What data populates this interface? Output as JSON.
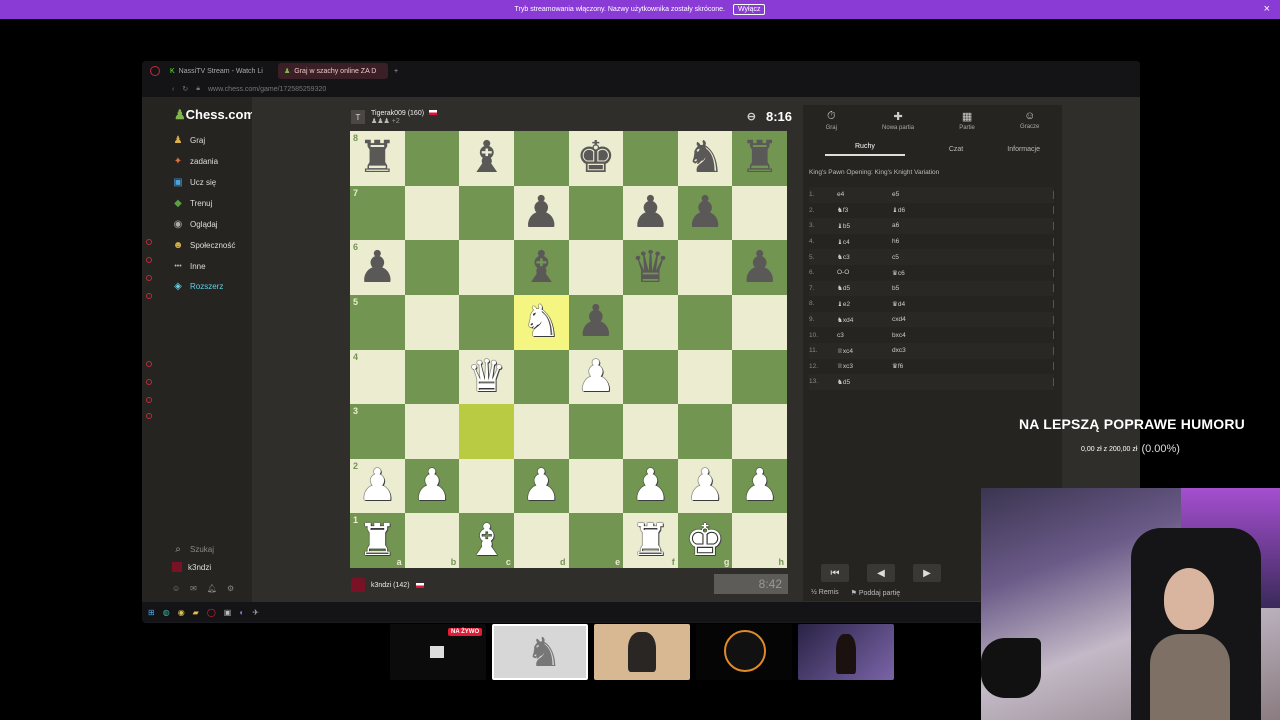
{
  "banner": {
    "text": "Tryb streamowania włączony. Nazwy użytkownika zostały skrócone.",
    "button": "Wyłącz",
    "close": "×"
  },
  "browser": {
    "tabs": [
      {
        "label": "NassiTV Stream - Watch Li"
      },
      {
        "label": "Graj w szachy online ZA D"
      }
    ],
    "new_tab": "+",
    "url": "www.chess.com/game/172585259320"
  },
  "site": {
    "logo_text": "Chess.com",
    "nav": [
      {
        "label": "Graj",
        "icon": "♟"
      },
      {
        "label": "zadania",
        "icon": "✦"
      },
      {
        "label": "Ucz się",
        "icon": "▣"
      },
      {
        "label": "Trenuj",
        "icon": "◆"
      },
      {
        "label": "Oglądaj",
        "icon": "◉"
      },
      {
        "label": "Społeczność",
        "icon": "☻"
      },
      {
        "label": "Inne",
        "icon": "•••"
      },
      {
        "label": "Rozszerz",
        "icon": "◈"
      }
    ],
    "search_label": "Szukaj",
    "user_label": "k3ndzi"
  },
  "game": {
    "opponent": {
      "name": "Tigerak009 (160)",
      "avatar": "T",
      "extra": "+2"
    },
    "player": {
      "name": "k3ndzi (142)"
    },
    "clock_top": "8:16",
    "clock_bottom": "8:42",
    "ranks": [
      "8",
      "7",
      "6",
      "5",
      "4",
      "3",
      "2",
      "1"
    ],
    "files": [
      "a",
      "b",
      "c",
      "d",
      "e",
      "f",
      "g",
      "h"
    ],
    "board": [
      [
        "br",
        "",
        "bb",
        "",
        "bk",
        "",
        "bn",
        "br"
      ],
      [
        "",
        "",
        "",
        "bp",
        "",
        "bp",
        "bp",
        ""
      ],
      [
        "bp",
        "",
        "",
        "bb",
        "",
        "bq",
        "",
        "bp"
      ],
      [
        "",
        "",
        "",
        "wn",
        "bp",
        "",
        "",
        ""
      ],
      [
        "",
        "",
        "wq",
        "",
        "wp",
        "",
        "",
        ""
      ],
      [
        "",
        "",
        "",
        "",
        "",
        "",
        "",
        ""
      ],
      [
        "wp",
        "wp",
        "",
        "wp",
        "",
        "wp",
        "wp",
        "wp"
      ],
      [
        "wr",
        "",
        "wb",
        "",
        "",
        "wr",
        "wk",
        ""
      ]
    ],
    "highlight_from": [
      5,
      2
    ],
    "highlight_to": [
      3,
      3
    ]
  },
  "panel": {
    "tools": [
      {
        "label": "Graj",
        "icon": "⏱"
      },
      {
        "label": "Nowa partia",
        "icon": "✚"
      },
      {
        "label": "Partie",
        "icon": "▦"
      },
      {
        "label": "Gracze",
        "icon": "☺"
      }
    ],
    "tabs": [
      "Ruchy",
      "Czat",
      "Informacje"
    ],
    "opening": "King's Pawn Opening: King's Knight Variation",
    "moves": [
      {
        "n": "1.",
        "w": "e4",
        "b": "e5"
      },
      {
        "n": "2.",
        "w": "♞f3",
        "b": "♝d6"
      },
      {
        "n": "3.",
        "w": "♝b5",
        "b": "a6"
      },
      {
        "n": "4.",
        "w": "♝c4",
        "b": "h6"
      },
      {
        "n": "5.",
        "w": "♞c3",
        "b": "c5"
      },
      {
        "n": "6.",
        "w": "O-O",
        "b": "♛c6"
      },
      {
        "n": "7.",
        "w": "♞d5",
        "b": "b5"
      },
      {
        "n": "8.",
        "w": "♝e2",
        "b": "♛d4"
      },
      {
        "n": "9.",
        "w": "♞xd4",
        "b": "cxd4"
      },
      {
        "n": "10.",
        "w": "c3",
        "b": "bxc4"
      },
      {
        "n": "11.",
        "w": "♕xc4",
        "b": "dxc3"
      },
      {
        "n": "12.",
        "w": "♕xc3",
        "b": "♛f6"
      },
      {
        "n": "13.",
        "w": "♞d5",
        "b": ""
      }
    ],
    "nav_buttons": [
      "⏮",
      "◀",
      "▶"
    ],
    "actions": [
      "½ Remis",
      "⚑ Poddaj partię"
    ]
  },
  "overlay": {
    "title": "NA LEPSZĄ POPRAWE HUMORU",
    "progress_text": "0,00 zł  z  200,00 zł",
    "progress_pct": "(0.00%)"
  },
  "thumbs": {
    "live_badge": "NA ŻYWO"
  }
}
